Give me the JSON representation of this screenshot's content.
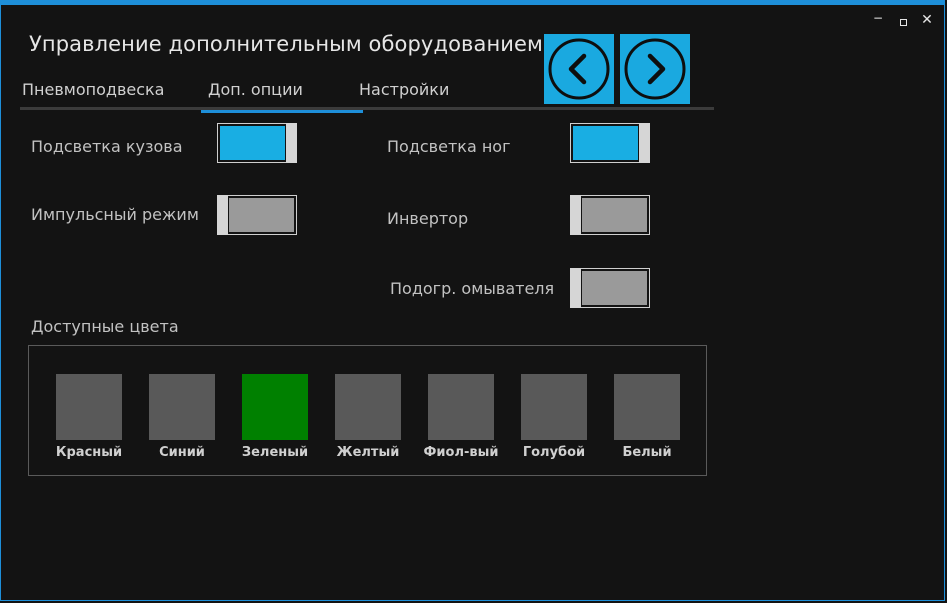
{
  "window": {
    "title": "Управление дополнительным оборудованием",
    "minimize_glyph": "−",
    "close_glyph": "✕"
  },
  "nav": {
    "prev_icon": "chevron-left-icon",
    "next_icon": "chevron-right-icon",
    "accent_color": "#1aa9e0"
  },
  "tabs": [
    {
      "label": "Пневмоподвеска",
      "active": false
    },
    {
      "label": "Доп. опции",
      "active": true
    },
    {
      "label": "Настройки",
      "active": false
    }
  ],
  "toggles": {
    "body_light": {
      "label": "Подсветка кузова",
      "on": true
    },
    "pulse_mode": {
      "label": "Импульсный режим",
      "on": false
    },
    "feet_light": {
      "label": "Подсветка ног",
      "on": true
    },
    "inverter": {
      "label": "Инвертор",
      "on": false
    },
    "washer_heat": {
      "label": "Подогр. омывателя",
      "on": false
    }
  },
  "colors": {
    "title": "Доступные цвета",
    "items": [
      {
        "label": "Красный",
        "color": "#595959",
        "selected": false
      },
      {
        "label": "Синий",
        "color": "#595959",
        "selected": false
      },
      {
        "label": "Зеленый",
        "color": "#008000",
        "selected": true
      },
      {
        "label": "Желтый",
        "color": "#595959",
        "selected": false
      },
      {
        "label": "Фиол-вый",
        "color": "#595959",
        "selected": false
      },
      {
        "label": "Голубой",
        "color": "#595959",
        "selected": false
      },
      {
        "label": "Белый",
        "color": "#595959",
        "selected": false
      }
    ]
  }
}
